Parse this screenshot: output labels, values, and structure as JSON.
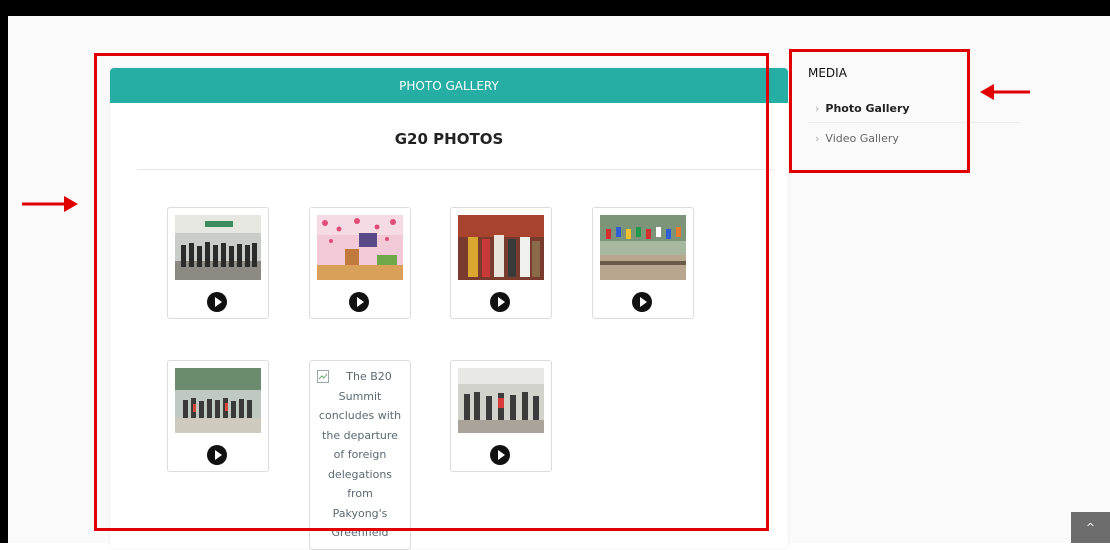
{
  "gallery": {
    "header_label": "PHOTO GALLERY",
    "section_title": "G20 PHOTOS",
    "items": [
      {
        "type": "photo"
      },
      {
        "type": "photo"
      },
      {
        "type": "photo"
      },
      {
        "type": "photo"
      },
      {
        "type": "photo"
      },
      {
        "type": "broken-image",
        "alt_text": "The B20\nSummit\nconcludes with\nthe departure\nof foreign\ndelegations\nfrom\nPakyong's\nGreenfield"
      },
      {
        "type": "photo"
      }
    ]
  },
  "sidebar": {
    "title": "MEDIA",
    "items": [
      {
        "label": "Photo Gallery",
        "active": true
      },
      {
        "label": "Video Gallery",
        "active": false
      }
    ]
  },
  "annotations": {
    "box_color": "#e00000",
    "arrow_color": "#e00000"
  },
  "colors": {
    "accent": "#26ada4"
  },
  "icons": {
    "play": "play-icon",
    "chevron": "chevron-right-icon",
    "scroll_top": "chevron-up-icon",
    "broken_image": "broken-image-icon"
  },
  "scroll_top": {
    "label": "^"
  }
}
